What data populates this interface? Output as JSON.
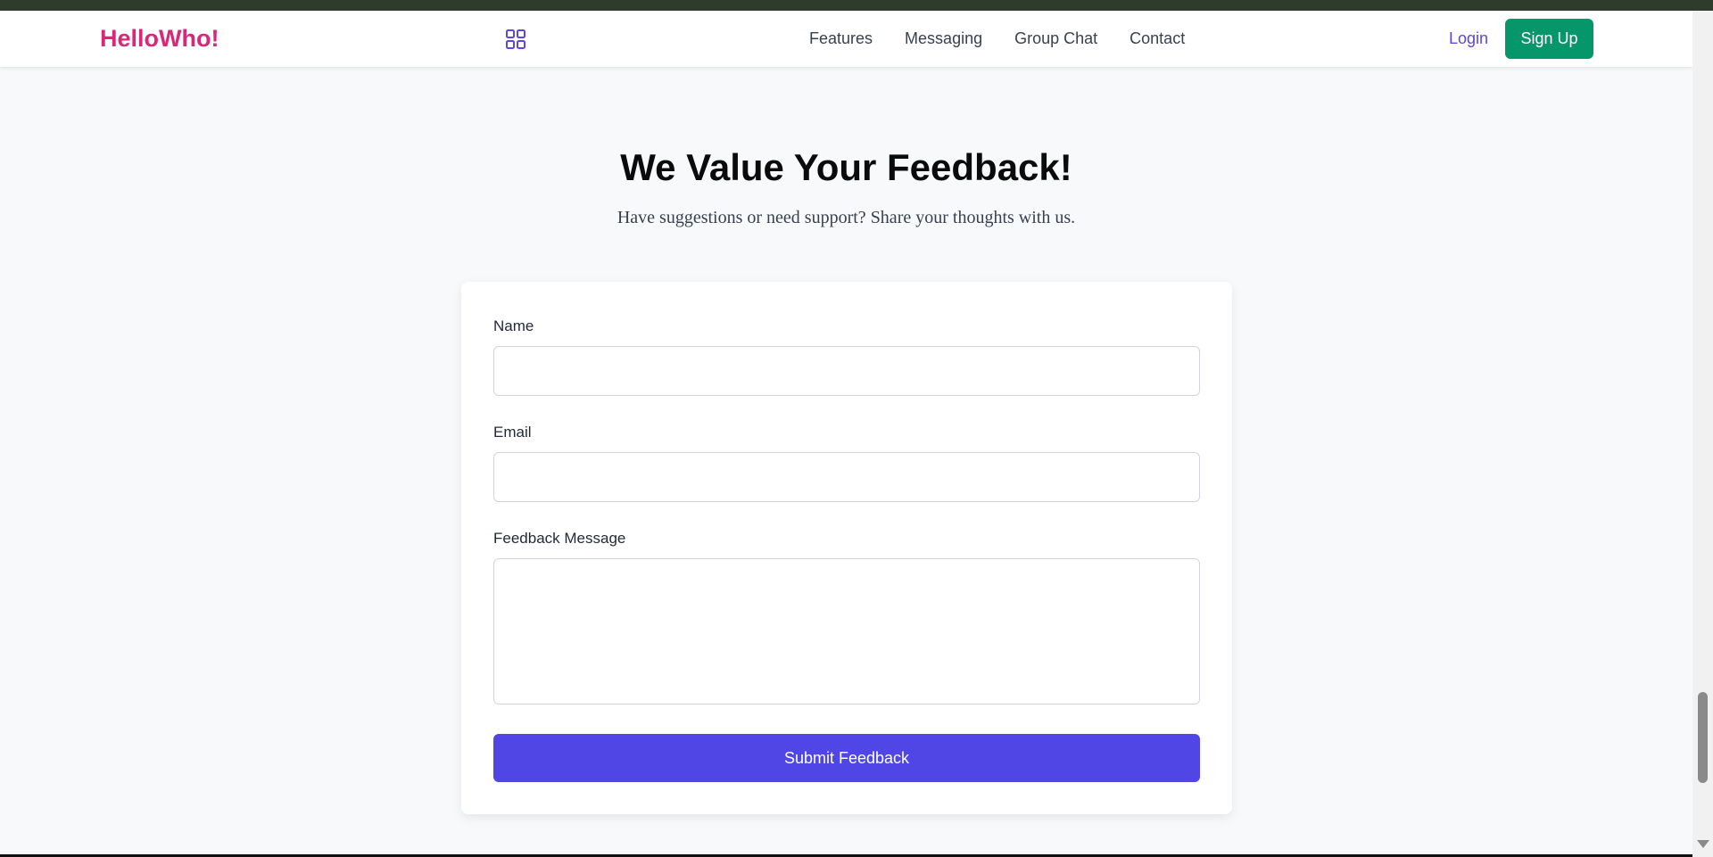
{
  "header": {
    "brand": "HelloWho!",
    "apps_icon": "grid-icon",
    "nav": [
      "Features",
      "Messaging",
      "Group Chat",
      "Contact"
    ],
    "login_label": "Login",
    "signup_label": "Sign Up"
  },
  "hero": {
    "title": "We Value Your Feedback!",
    "subtitle": "Have suggestions or need support? Share your thoughts with us."
  },
  "form": {
    "name_label": "Name",
    "name_value": "",
    "email_label": "Email",
    "email_value": "",
    "message_label": "Feedback Message",
    "message_value": "",
    "submit_label": "Submit Feedback"
  },
  "colors": {
    "brand": "#db2777",
    "accent": "#4f46e5",
    "signup": "#059669"
  }
}
